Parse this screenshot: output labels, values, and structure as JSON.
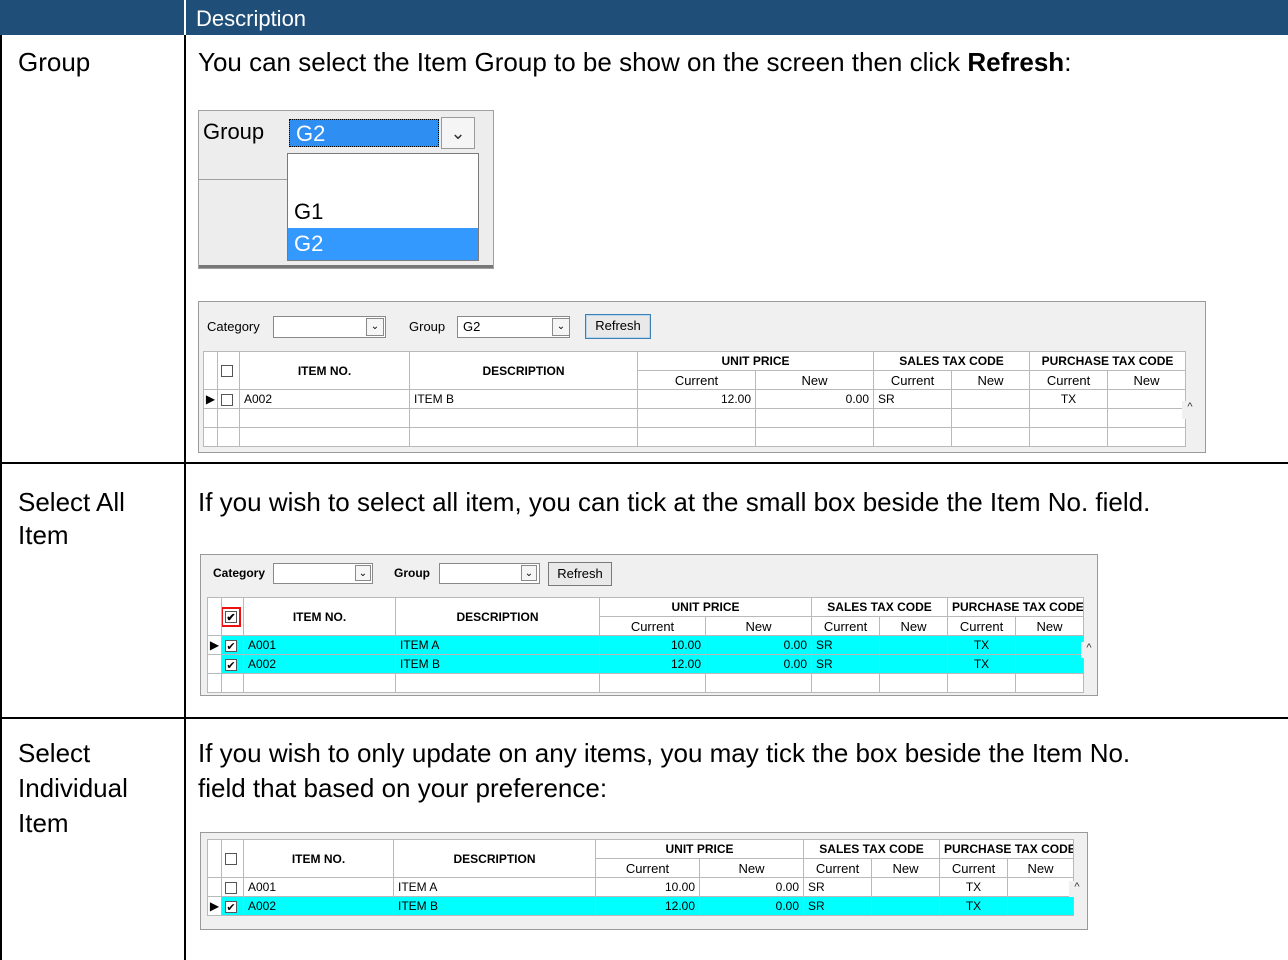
{
  "header": {
    "description_label": "Description"
  },
  "rows": [
    {
      "label": "Group",
      "text_before": "You can select the Item Group to be show on the screen then click ",
      "text_bold": "Refresh",
      "text_after": ":"
    },
    {
      "label_line1": "Select All",
      "label_line2": "Item",
      "text": "If you wish to select all item, you can tick at the small box beside the Item No. field."
    },
    {
      "label_line1": "Select",
      "label_line2": "Individual",
      "label_line3": "Item",
      "text_line1": "If you wish to only update on any items, you may tick the box beside the Item No.",
      "text_line2": "field that based on your preference:"
    }
  ],
  "combo": {
    "label": "Group",
    "value": "G2",
    "options": [
      "",
      "G1",
      "G2"
    ],
    "selected": "G2"
  },
  "grid_common": {
    "col_item_no": "ITEM NO.",
    "col_description": "DESCRIPTION",
    "col_unit_price": "UNIT PRICE",
    "col_sales_tax": "SALES TAX CODE",
    "col_purchase_tax": "PURCHASE TAX CODE",
    "sub_current": "Current",
    "sub_new": "New",
    "category_label": "Category",
    "group_label": "Group",
    "refresh_label": "Refresh"
  },
  "grid1": {
    "group_value": "G2",
    "rows": [
      {
        "item_no": "A002",
        "description": "ITEM B",
        "price_current": "12.00",
        "price_new": "0.00",
        "sales_tax": "SR",
        "purchase_tax": "TX"
      }
    ]
  },
  "grid2": {
    "rows": [
      {
        "item_no": "A001",
        "description": "ITEM A",
        "price_current": "10.00",
        "price_new": "0.00",
        "sales_tax": "SR",
        "purchase_tax": "TX"
      },
      {
        "item_no": "A002",
        "description": "ITEM B",
        "price_current": "12.00",
        "price_new": "0.00",
        "sales_tax": "SR",
        "purchase_tax": "TX"
      }
    ]
  },
  "grid3": {
    "rows": [
      {
        "item_no": "A001",
        "description": "ITEM A",
        "price_current": "10.00",
        "price_new": "0.00",
        "sales_tax": "SR",
        "purchase_tax": "TX"
      },
      {
        "item_no": "A002",
        "description": "ITEM B",
        "price_current": "12.00",
        "price_new": "0.00",
        "sales_tax": "SR",
        "purchase_tax": "TX"
      }
    ]
  },
  "icons": {
    "checkmark": "✔",
    "dropdown": "⌄",
    "row_pointer": "▶",
    "scroll_up": "^"
  }
}
